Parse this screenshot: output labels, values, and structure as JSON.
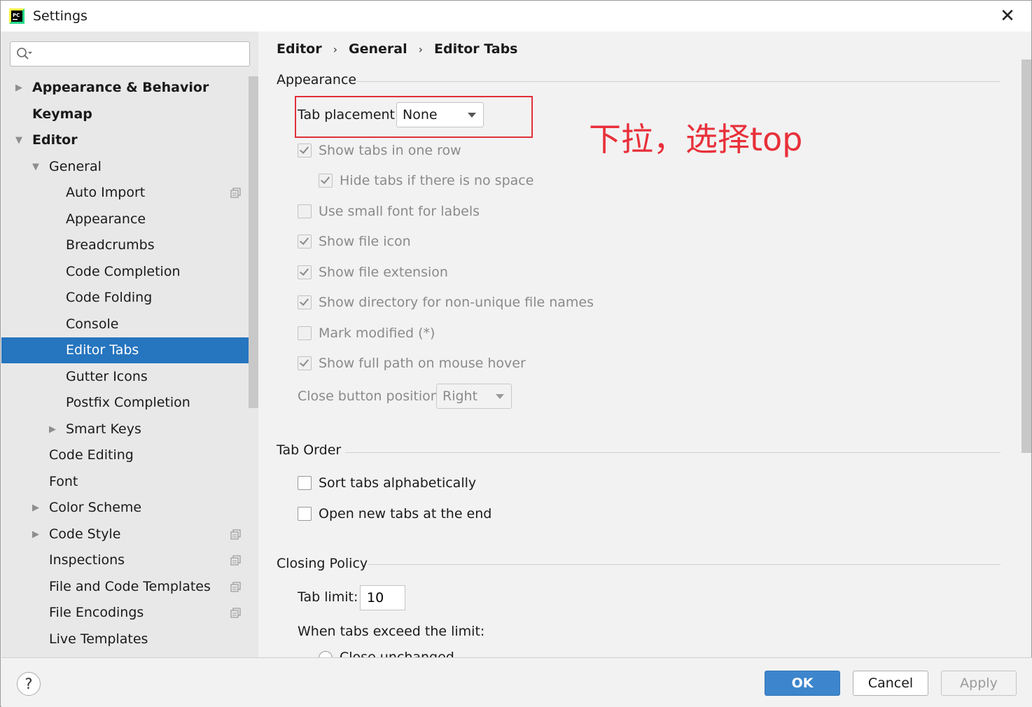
{
  "window": {
    "title": "Settings",
    "app_icon": "pycharm-icon",
    "close_icon": "close-icon"
  },
  "search": {
    "placeholder": "",
    "value": ""
  },
  "sidebar": {
    "items": [
      {
        "label": "Appearance & Behavior",
        "arrow": "▶",
        "bold": true,
        "copy": false
      },
      {
        "label": "Keymap",
        "arrow": "",
        "bold": true,
        "copy": false
      },
      {
        "label": "Editor",
        "arrow": "▼",
        "bold": true,
        "copy": false
      },
      {
        "label": "General",
        "arrow": "▼",
        "bold": false,
        "copy": false
      },
      {
        "label": "Auto Import",
        "arrow": "",
        "bold": false,
        "copy": true
      },
      {
        "label": "Appearance",
        "arrow": "",
        "bold": false,
        "copy": false
      },
      {
        "label": "Breadcrumbs",
        "arrow": "",
        "bold": false,
        "copy": false
      },
      {
        "label": "Code Completion",
        "arrow": "",
        "bold": false,
        "copy": false
      },
      {
        "label": "Code Folding",
        "arrow": "",
        "bold": false,
        "copy": false
      },
      {
        "label": "Console",
        "arrow": "",
        "bold": false,
        "copy": false
      },
      {
        "label": "Editor Tabs",
        "arrow": "",
        "bold": false,
        "copy": false,
        "selected": true
      },
      {
        "label": "Gutter Icons",
        "arrow": "",
        "bold": false,
        "copy": false
      },
      {
        "label": "Postfix Completion",
        "arrow": "",
        "bold": false,
        "copy": false
      },
      {
        "label": "Smart Keys",
        "arrow": "▶",
        "bold": false,
        "copy": false
      },
      {
        "label": "Code Editing",
        "arrow": "",
        "bold": false,
        "copy": false
      },
      {
        "label": "Font",
        "arrow": "",
        "bold": false,
        "copy": false
      },
      {
        "label": "Color Scheme",
        "arrow": "▶",
        "bold": false,
        "copy": false
      },
      {
        "label": "Code Style",
        "arrow": "▶",
        "bold": false,
        "copy": true
      },
      {
        "label": "Inspections",
        "arrow": "",
        "bold": false,
        "copy": true
      },
      {
        "label": "File and Code Templates",
        "arrow": "",
        "bold": false,
        "copy": true
      },
      {
        "label": "File Encodings",
        "arrow": "",
        "bold": false,
        "copy": true
      },
      {
        "label": "Live Templates",
        "arrow": "",
        "bold": false,
        "copy": false
      }
    ]
  },
  "breadcrumb": {
    "items": [
      "Editor",
      "General",
      "Editor Tabs"
    ],
    "separator": "›"
  },
  "appearance": {
    "title": "Appearance",
    "tab_placement_label": "Tab placement:",
    "tab_placement_value": "None",
    "checkboxes": [
      {
        "label": "Show tabs in one row",
        "checked": true,
        "enabled": false
      },
      {
        "label": "Hide tabs if there is no space",
        "checked": true,
        "enabled": false
      },
      {
        "label": "Use small font for labels",
        "checked": false,
        "enabled": false
      },
      {
        "label": "Show file icon",
        "checked": true,
        "enabled": false
      },
      {
        "label": "Show file extension",
        "checked": true,
        "enabled": false
      },
      {
        "label": "Show directory for non-unique file names",
        "checked": true,
        "enabled": false
      },
      {
        "label": "Mark modified (*)",
        "checked": false,
        "enabled": false
      },
      {
        "label": "Show full path on mouse hover",
        "checked": true,
        "enabled": false
      }
    ],
    "close_button_label": "Close button position:",
    "close_button_value": "Right"
  },
  "annotation": "下拉，选择top",
  "tab_order": {
    "title": "Tab Order",
    "checkboxes": [
      {
        "label": "Sort tabs alphabetically",
        "checked": false,
        "enabled": true
      },
      {
        "label": "Open new tabs at the end",
        "checked": false,
        "enabled": true
      }
    ]
  },
  "closing_policy": {
    "title": "Closing Policy",
    "tab_limit_label": "Tab limit:",
    "tab_limit_value": "10",
    "exceed_label": "When tabs exceed the limit:",
    "radio_label": "Close unchanged"
  },
  "buttons": {
    "help": "?",
    "ok": "OK",
    "cancel": "Cancel",
    "apply": "Apply"
  },
  "colors": {
    "selection": "#2675bf",
    "annotation": "#e8303a",
    "ok_button": "#3d85cc"
  }
}
